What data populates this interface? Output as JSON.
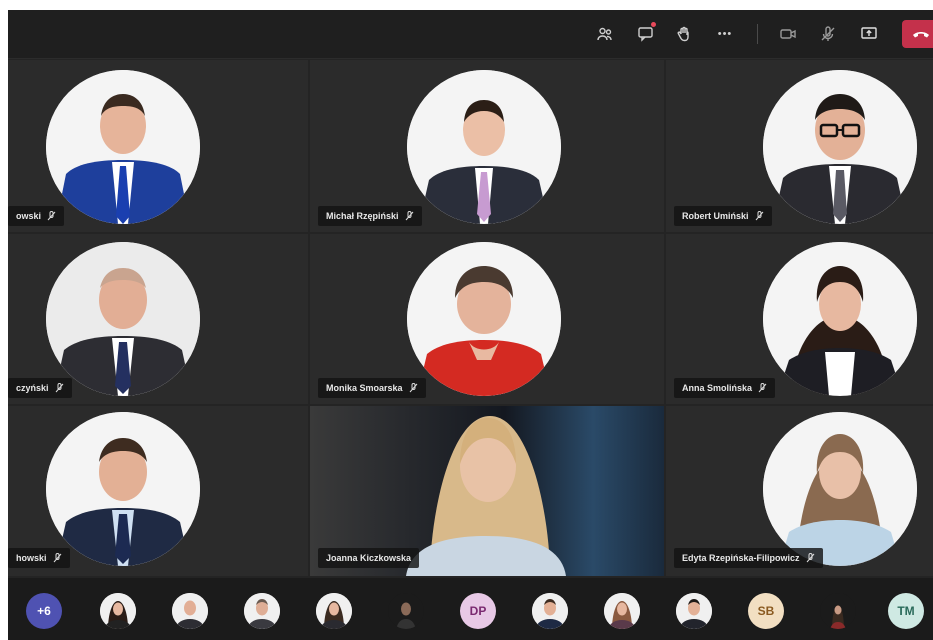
{
  "toolbar": {
    "more_label": "•••",
    "colors": {
      "leave": "#c4314b",
      "bar": "#1f1f1f"
    }
  },
  "tiles": [
    {
      "name": "owski"
    },
    {
      "name": "Michał Rzępiński"
    },
    {
      "name": "Robert Umiński"
    },
    {
      "name": "czyński"
    },
    {
      "name": "Monika Smoarska"
    },
    {
      "name": "Anna Smolińska"
    },
    {
      "name": "howski"
    },
    {
      "name": "Joanna Kiczkowska"
    },
    {
      "name": "Edyta Rzepińska-Filipowicz"
    }
  ],
  "strip": {
    "overflow_count": "+6",
    "initials": [
      "DP",
      "SB",
      "TM"
    ],
    "colors": {
      "overflow": "#4f52b2",
      "DP": "#e8c9e6",
      "SB": "#f2dfc2",
      "TM": "#cfe9e3"
    }
  }
}
